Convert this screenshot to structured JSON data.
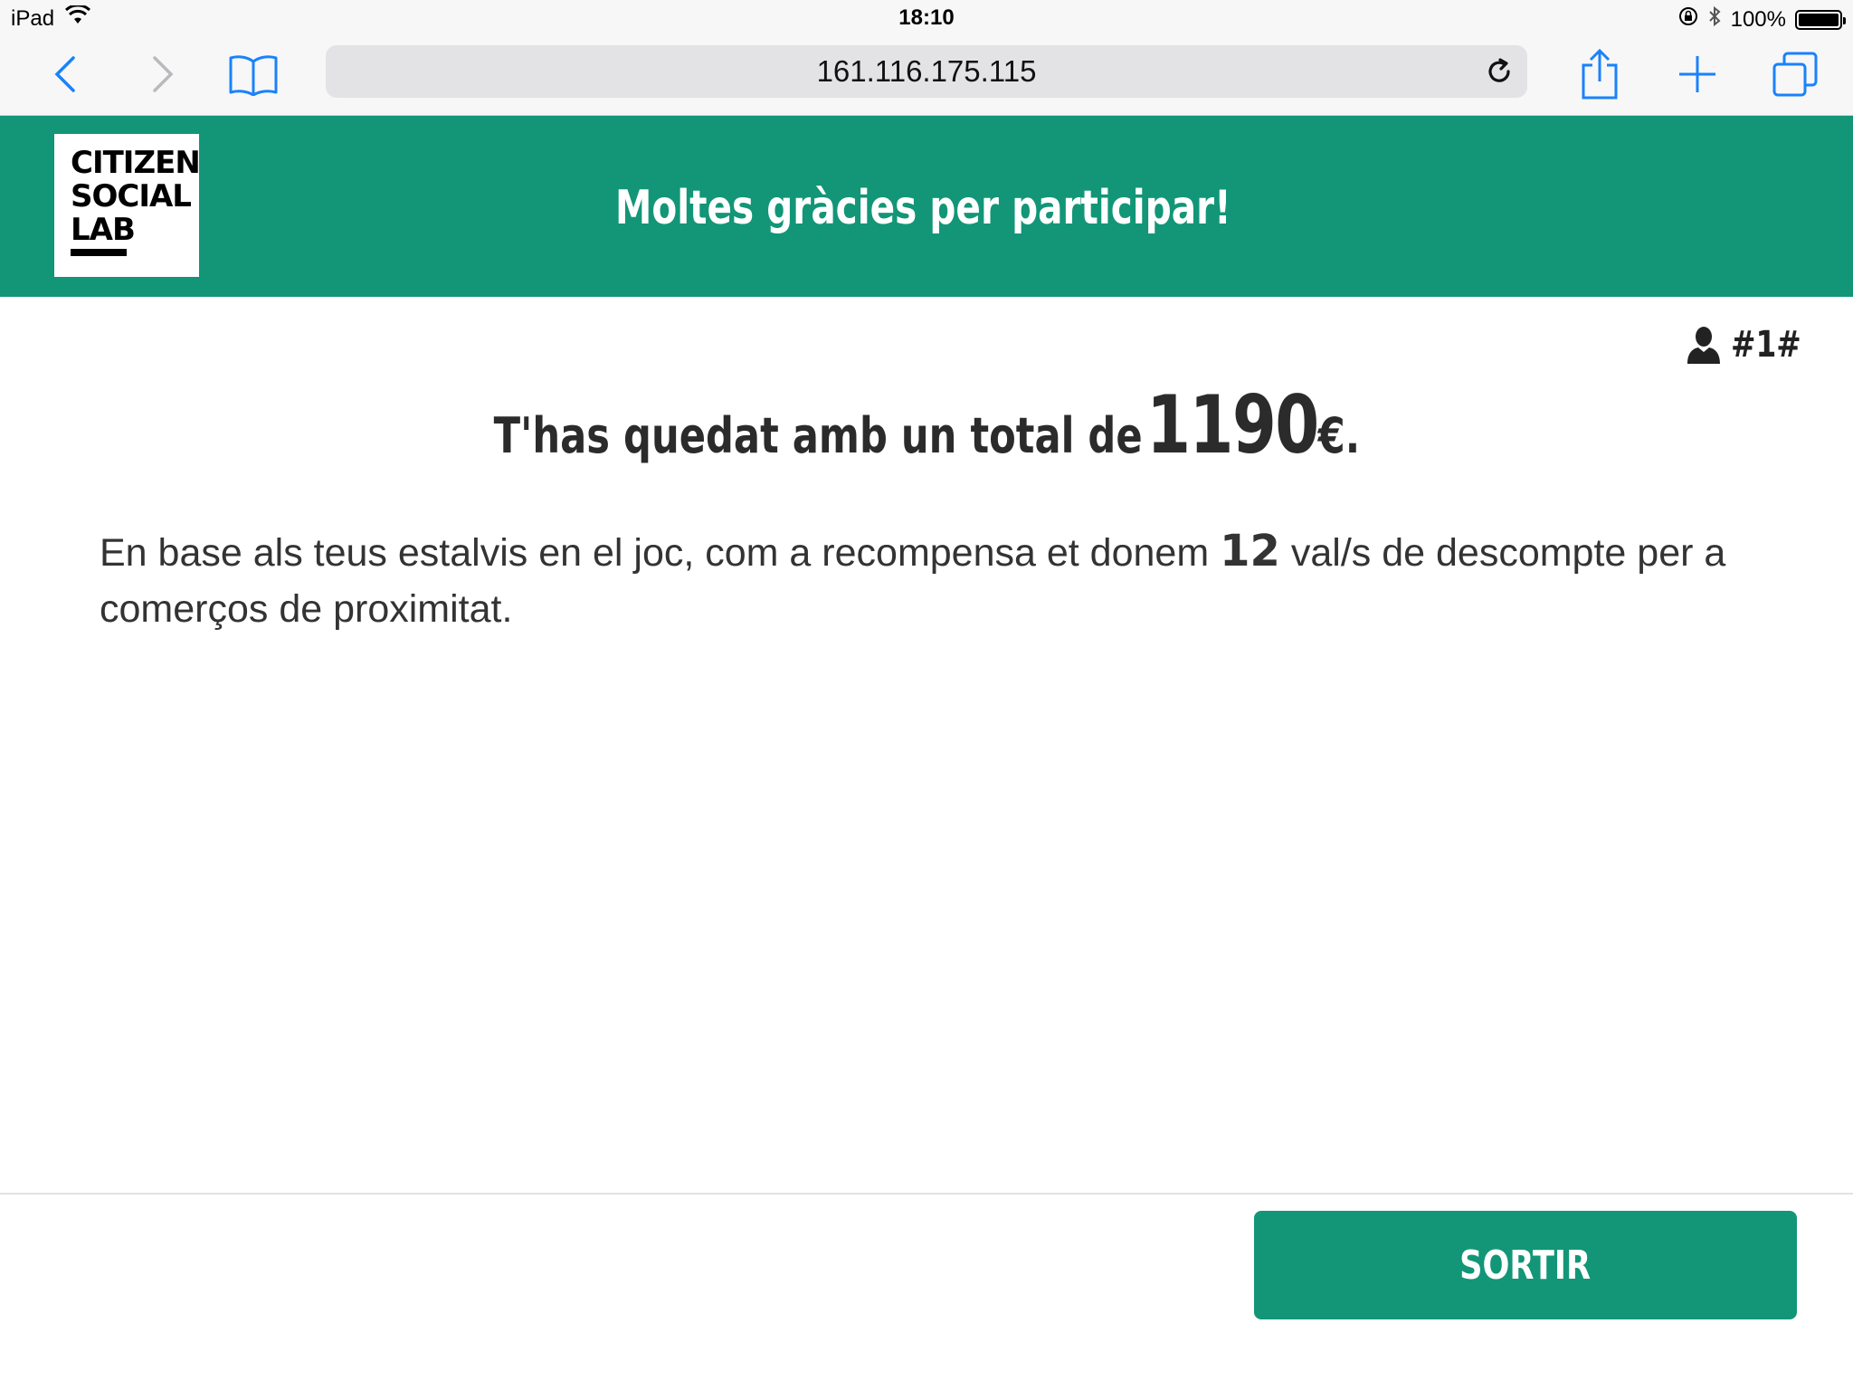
{
  "status_bar": {
    "device": "iPad",
    "time": "18:10",
    "battery": "100%"
  },
  "browser": {
    "url": "161.116.175.115"
  },
  "header": {
    "logo_lines": [
      "CITIZEN",
      "SOCIAL",
      "LAB"
    ],
    "title": "Moltes gràcies per participar!"
  },
  "user": {
    "code": "#1#"
  },
  "result": {
    "text": "T'has quedat amb un total de",
    "amount": "1190",
    "currency": "€."
  },
  "reward": {
    "prefix": "En base als teus estalvis en el joc, com a recompensa et donem",
    "count": "12",
    "suffix": "val/s de descompte per a comerços de proximitat."
  },
  "footer": {
    "exit_label": "SORTIR"
  },
  "colors": {
    "brand_green": "#129677",
    "ios_blue": "#1a82fb"
  }
}
